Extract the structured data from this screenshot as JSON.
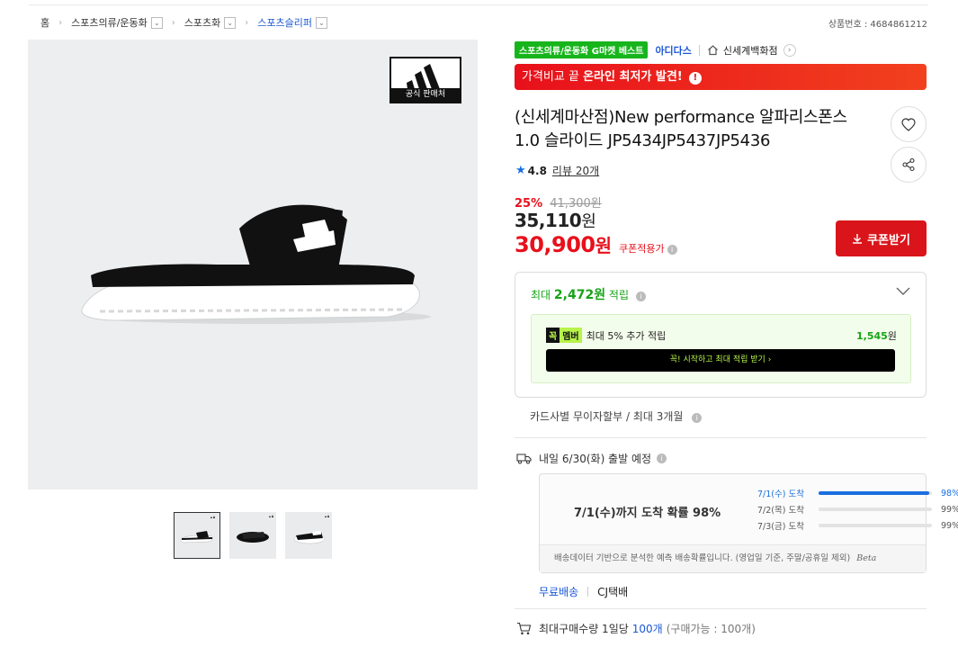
{
  "breadcrumb": {
    "home": "홈",
    "level1": "스포츠의류/운동화",
    "level2": "스포츠화",
    "level3": "스포츠슬리퍼"
  },
  "product_number": "상품번호 : 4684861212",
  "image_badge": "공식 판매처",
  "tags": {
    "best": "스포츠의류/운동화 G마켓 베스트",
    "brand": "아디다스",
    "store": "신세계백화점"
  },
  "promo_banner": {
    "prefix": "가격비교 끝",
    "highlight": "온라인 최저가 발견!"
  },
  "title": "(신세계마산점)New performance 알파리스폰스 1.0 슬라이드 JP5434JP5437JP5436",
  "rating": {
    "score": "4.8",
    "reviews": "리뷰 20개"
  },
  "price": {
    "discount_pct": "25%",
    "original": "41,300원",
    "sale": "35,110",
    "sale_unit": "원",
    "coupon_price": "30,900",
    "coupon_unit": "원",
    "coupon_note": "쿠폰적용가"
  },
  "coupon_button": "쿠폰받기",
  "points": {
    "prefix": "최대",
    "amount": "2,472원",
    "suffix": "적립",
    "member_logo_a": "꼭",
    "member_logo_b": "멤버",
    "member_text": "최대 5% 추가 적립",
    "member_value": "1,545",
    "member_value_unit": "원",
    "member_cta": "꼭! 시작하고 최대 적립 받기  ›"
  },
  "installment": "카드사별 무이자할부 / 최대 3개월",
  "shipping": {
    "label": "내일 6/30(화) 출발 예정",
    "probability_main": "7/1(수)까지 도착 확률 98%",
    "rows": [
      {
        "label": "7/1(수) 도착",
        "pct": "98%",
        "value": 98
      },
      {
        "label": "7/2(목) 도착",
        "pct": "99%",
        "value": 0
      },
      {
        "label": "7/3(금) 도착",
        "pct": "99%",
        "value": 0
      }
    ],
    "note": "배송데이터 기반으로 분석한 예측 배송확률입니다. (영업일 기준, 주말/공휴일 제외)",
    "beta": "Beta",
    "free": "무료배송",
    "carrier": "CJ택배"
  },
  "max_qty": {
    "prefix": "최대구매수량 1일당",
    "value": "100개",
    "suffix": "(구매가능 : 100개)"
  },
  "colors": {
    "accent_red": "#e8101b",
    "link_blue": "#1a57d6",
    "point_green": "#17a317"
  }
}
